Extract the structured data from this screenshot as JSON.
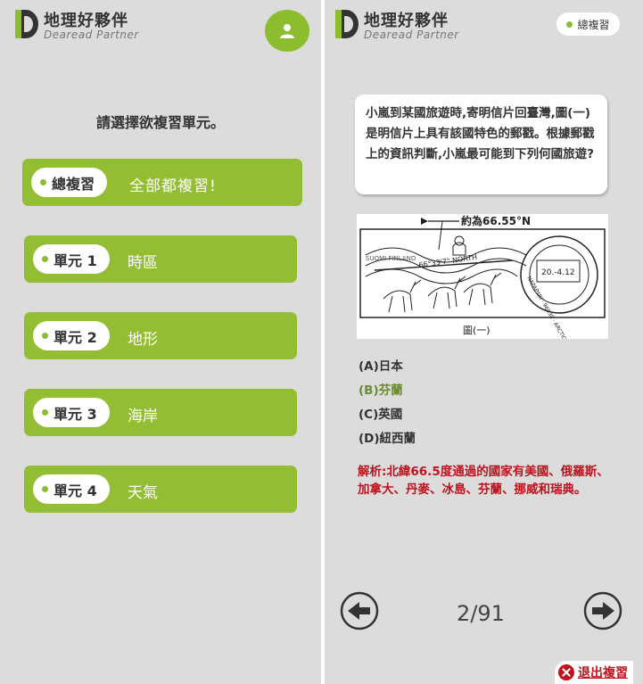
{
  "brand": {
    "name_cn": "地理好夥伴",
    "name_en": "Dearead Partner"
  },
  "review_select": {
    "prompt": "請選擇欲複習單元。",
    "units": [
      {
        "tag": "總複習",
        "desc": "全部都複習!"
      },
      {
        "tag": "單元 1",
        "desc": "時區"
      },
      {
        "tag": "單元 2",
        "desc": "地形"
      },
      {
        "tag": "單元 3",
        "desc": "海岸"
      },
      {
        "tag": "單元 4",
        "desc": "天氣"
      }
    ]
  },
  "quiz": {
    "mode_badge": "總複習",
    "question": "小嵐到某國旅遊時,寄明信片回臺灣,圖(一)是明信片上具有該國特色的郵戳。根據郵戳上的資訊判斷,小嵐最可能到下列何國旅遊?",
    "figure": {
      "latitude_label": "約為66.55°N",
      "caption": "圖(一)",
      "stamp_date": "20.-4.12",
      "stamp_line_text": "66°33'7\" NORTH",
      "postmark_text": "NAPAPIIRI · 96930 · ARCTIC CIRCLE",
      "wavy_text": "SUOMI FINLAND"
    },
    "options": [
      {
        "label": "(A)日本",
        "correct": false
      },
      {
        "label": "(B)芬蘭",
        "correct": true
      },
      {
        "label": "(C)英國",
        "correct": false
      },
      {
        "label": "(D)紐西蘭",
        "correct": false
      }
    ],
    "explanation": "解析:北緯66.5度通過的國家有美國、俄羅斯、加拿大、丹麥、冰島、芬蘭、挪威和瑞典。",
    "page_indicator": "2/91",
    "exit_label": "退出複習"
  },
  "colors": {
    "accent_green": "#8cbd2f",
    "answer_green": "#6b8c2a",
    "explain_red": "#c0121c",
    "panel_bg": "#dcdcdc"
  },
  "icons": [
    "brand-logo-icon",
    "user-icon",
    "prev-arrow-icon",
    "next-arrow-icon",
    "close-circle-icon"
  ]
}
